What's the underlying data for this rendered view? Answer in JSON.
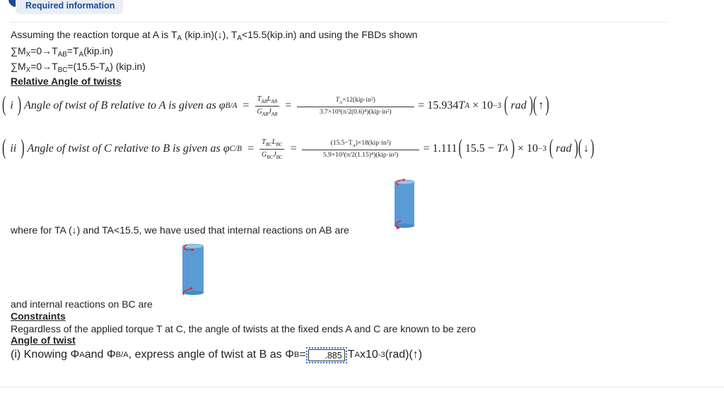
{
  "badge": {
    "label": "Required information",
    "color": "#1d4a8f",
    "bg": "#e9eef7"
  },
  "intro": {
    "line1_prefix": "Assuming the reaction torque at A is T",
    "line1_sub": "A",
    "line1_mid": " (kip.in)(↓), T",
    "line1_sub2": "A",
    "line1_suffix": "<15.5(kip.in) and using the FBDs shown",
    "eq1": {
      "sigma": "∑M",
      "sub_x": "X",
      "mid": "=0→T",
      "sub_ab": "AB",
      "eq": "=T",
      "sub_a": "A",
      "tail": "(kip.in)"
    },
    "eq2": {
      "sigma": "∑M",
      "sub_x": "X",
      "mid": "=0→T",
      "sub_bc": "BC",
      "eq": "=(15.5-T",
      "sub_a": "A",
      "tail": ") (kip.in)"
    }
  },
  "relative_heading": "Relative Angle of twists",
  "formula_i": {
    "index": "i",
    "text": "Angle of twist of B relative to A is given as φ",
    "sub": "B/A",
    "frac_num": "Tₐᴮ Lₐᴮ",
    "num_T": "T",
    "num_T_sub": "AB",
    "num_L": "L",
    "num_L_sub": "AB",
    "den_G": "G",
    "den_G_sub": "AB",
    "den_J": "J",
    "den_J_sub": "AB",
    "num2": "T",
    "num2_sub": "A",
    "num2_rest": "×12(kip·in²)",
    "den2": "3.7×10³(π/2(0.6)⁴)(kip·in²)",
    "result_coef": "= 15.934",
    "result_T": "T",
    "result_T_sub": "A",
    "result_tail": "× 10",
    "result_exp": "−3",
    "unit": "rad",
    "direction": "↑"
  },
  "formula_ii": {
    "index": "ii",
    "text": "Angle of twist of C relative to B is given as φ",
    "sub": "C/B",
    "num_T": "T",
    "num_T_sub": "BC",
    "num_L": "L",
    "num_L_sub": "BC",
    "den_G": "G",
    "den_G_sub": "BC",
    "den_J": "J",
    "den_J_sub": "BC",
    "num2": "(15.5−T",
    "num2_sub": "A",
    "num2_rest": ")×18(kip·in²)",
    "den2": "5.9×10³(π/2(1.15)⁴)(kip·in²)",
    "result_coef": "= 1.111",
    "result_inner": "15.5 − ",
    "result_T": "T",
    "result_T_sub": "A",
    "result_tail": "× 10",
    "result_exp": "−3",
    "unit": "rad",
    "direction": "↓"
  },
  "ab_text": "where for TA (↓) and TA<15.5, we have used that internal reactions on AB are",
  "bc_text": "and internal reactions on BC are",
  "constraints_heading": "Constraints",
  "constraints_text": "Regardless of the applied torque T at C, the angle of twists at the fixed ends A and C are known to be zero",
  "angle_heading": "Angle of twist",
  "question": {
    "prefix": "(i) Knowing Φ",
    "sub_a": "A",
    "mid": " and Φ",
    "sub_ba": "B/A",
    "mid2": ", express angle of twist at B as Φ",
    "sub_b": "B",
    "eq": "=",
    "answer_value": ".885",
    "after_T": "T",
    "after_sub": "A",
    "after": " x10",
    "exp": "-3",
    "tail": "(rad)(↑)"
  },
  "colors": {
    "cylinder": "#5b9bd5",
    "cylinder_top": "#9dc3e6",
    "torque_arrow": "#e02020"
  }
}
